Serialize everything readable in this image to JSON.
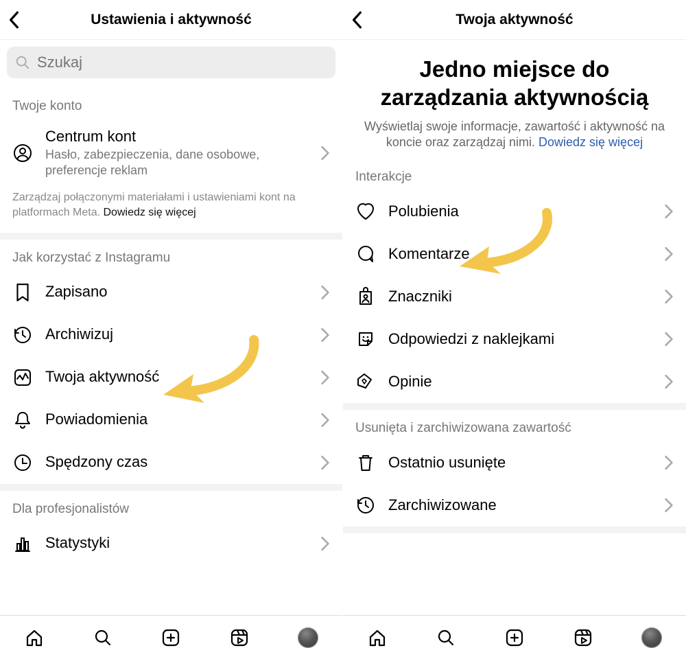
{
  "left": {
    "title": "Ustawienia i aktywność",
    "search_placeholder": "Szukaj",
    "sections": {
      "account_title": "Twoje konto",
      "account_center_title": "Centrum kont",
      "account_center_sub": "Hasło, zabezpieczenia, dane osobowe, preferencje reklam",
      "account_meta_note_prefix": "Zarządzaj połączonymi materiałami i ustawieniami kont na platformach Meta. ",
      "account_meta_note_link": "Dowiedz się więcej",
      "usage_title": "Jak korzystać z Instagramu",
      "usage_items": [
        {
          "icon": "bookmark",
          "label": "Zapisano"
        },
        {
          "icon": "archive",
          "label": "Archiwizuj"
        },
        {
          "icon": "activity",
          "label": "Twoja aktywność"
        },
        {
          "icon": "bell",
          "label": "Powiadomienia"
        },
        {
          "icon": "clock",
          "label": "Spędzony czas"
        }
      ],
      "pro_title": "Dla profesjonalistów",
      "pro_items": [
        {
          "icon": "stats",
          "label": "Statystyki"
        }
      ]
    }
  },
  "right": {
    "title": "Twoja aktywność",
    "hero_title": "Jedno miejsce do zarządzania aktywnością",
    "hero_sub": "Wyświetlaj swoje informacje, zawartość i aktywność na koncie oraz zarządzaj nimi. ",
    "hero_link": "Dowiedz się więcej",
    "sections": {
      "interactions_title": "Interakcje",
      "interactions_items": [
        {
          "icon": "heart",
          "label": "Polubienia"
        },
        {
          "icon": "comment",
          "label": "Komentarze"
        },
        {
          "icon": "tag",
          "label": "Znaczniki"
        },
        {
          "icon": "sticker",
          "label": "Odpowiedzi z naklejkami"
        },
        {
          "icon": "opinion",
          "label": "Opinie"
        }
      ],
      "deleted_title": "Usunięta i zarchiwizowana zawartość",
      "deleted_items": [
        {
          "icon": "trash",
          "label": "Ostatnio usunięte"
        },
        {
          "icon": "archived",
          "label": "Zarchiwizowane"
        }
      ]
    }
  },
  "annotations": {
    "arrow_left_target": "Twoja aktywność",
    "arrow_right_target": "Polubienia"
  }
}
